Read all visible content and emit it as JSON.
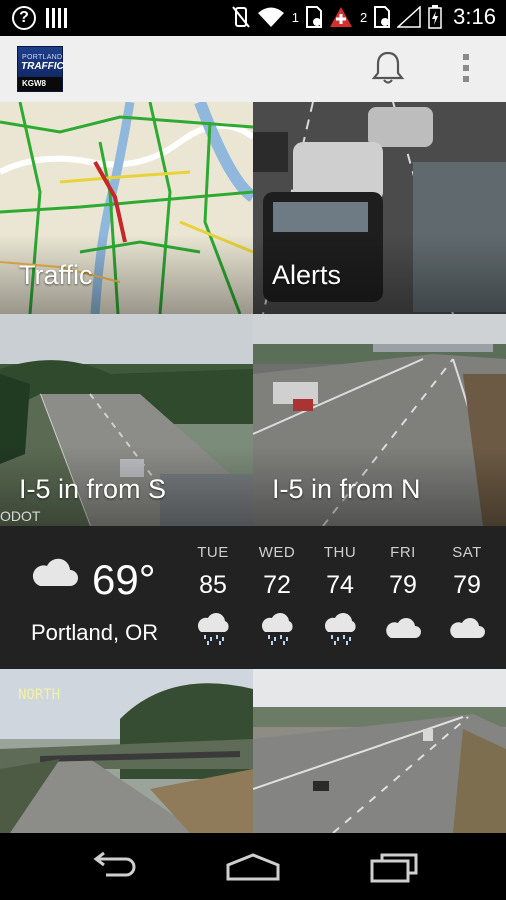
{
  "status_bar": {
    "time": "3:16",
    "badge_1": "1",
    "badge_2": "2"
  },
  "app_bar": {
    "logo_line1": "PORTLAND",
    "logo_line2": "TRAFFIC",
    "logo_line3": "KGW8"
  },
  "tiles": {
    "traffic": "Traffic",
    "alerts": "Alerts",
    "i5_south": "I-5 in from S",
    "i5_north": "I-5 in from N",
    "cam3_overlay": "NORTH",
    "i5s_watermark": "ODOT"
  },
  "weather": {
    "current_temp": "69°",
    "location": "Portland, OR",
    "forecast": [
      {
        "day": "TUE",
        "temp": "85",
        "icon": "rain-cloud-icon"
      },
      {
        "day": "WED",
        "temp": "72",
        "icon": "rain-cloud-icon"
      },
      {
        "day": "THU",
        "temp": "74",
        "icon": "rain-cloud-icon"
      },
      {
        "day": "FRI",
        "temp": "79",
        "icon": "cloud-icon"
      },
      {
        "day": "SAT",
        "temp": "79",
        "icon": "cloud-icon"
      }
    ]
  },
  "colors": {
    "appbar_bg": "#efefef",
    "weather_bg": "#222222",
    "alert_red": "#d32f2f"
  }
}
